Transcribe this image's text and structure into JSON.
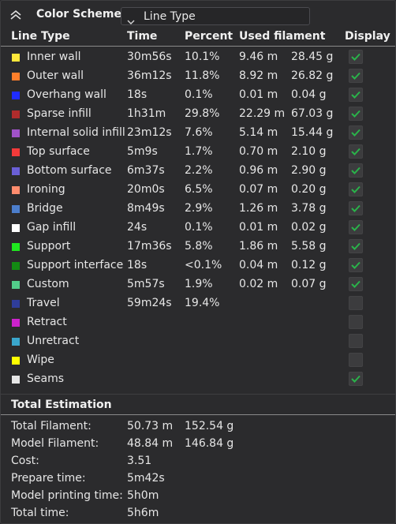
{
  "header": {
    "title": "Color Scheme",
    "view_type": "Line Type"
  },
  "columns": {
    "line_type": "Line Type",
    "time": "Time",
    "percent": "Percent",
    "used_filament": "Used filament",
    "display": "Display"
  },
  "rows": [
    {
      "label": "Inner wall",
      "color": "#ffe83b",
      "time": "30m56s",
      "percent": "10.1%",
      "length": "9.46 m",
      "weight": "28.45 g",
      "display": true
    },
    {
      "label": "Outer wall",
      "color": "#ff7f2b",
      "time": "36m12s",
      "percent": "11.8%",
      "length": "8.92 m",
      "weight": "26.82 g",
      "display": true
    },
    {
      "label": "Overhang wall",
      "color": "#1f2cff",
      "time": "18s",
      "percent": "0.1%",
      "length": "0.01 m",
      "weight": "0.04 g",
      "display": true
    },
    {
      "label": "Sparse infill",
      "color": "#b02c2c",
      "time": "1h31m",
      "percent": "29.8%",
      "length": "22.29 m",
      "weight": "67.03 g",
      "display": true
    },
    {
      "label": "Internal solid infill",
      "color": "#a052c8",
      "time": "23m12s",
      "percent": "7.6%",
      "length": "5.14 m",
      "weight": "15.44 g",
      "display": true
    },
    {
      "label": "Top surface",
      "color": "#f23a3a",
      "time": "5m9s",
      "percent": "1.7%",
      "length": "0.70 m",
      "weight": "2.10 g",
      "display": true
    },
    {
      "label": "Bottom surface",
      "color": "#6a5fd6",
      "time": "6m37s",
      "percent": "2.2%",
      "length": "0.96 m",
      "weight": "2.90 g",
      "display": true
    },
    {
      "label": "Ironing",
      "color": "#ff8c6e",
      "time": "20m0s",
      "percent": "6.5%",
      "length": "0.07 m",
      "weight": "0.20 g",
      "display": true
    },
    {
      "label": "Bridge",
      "color": "#4c7ecc",
      "time": "8m49s",
      "percent": "2.9%",
      "length": "1.26 m",
      "weight": "3.78 g",
      "display": true
    },
    {
      "label": "Gap infill",
      "color": "#ffffff",
      "time": "24s",
      "percent": "0.1%",
      "length": "0.01 m",
      "weight": "0.02 g",
      "display": true
    },
    {
      "label": "Support",
      "color": "#1fe81f",
      "time": "17m36s",
      "percent": "5.8%",
      "length": "1.86 m",
      "weight": "5.58 g",
      "display": true
    },
    {
      "label": "Support interface",
      "color": "#138a13",
      "time": "18s",
      "percent": "<0.1%",
      "length": "0.04 m",
      "weight": "0.12 g",
      "display": true
    },
    {
      "label": "Custom",
      "color": "#52cc8a",
      "time": "5m57s",
      "percent": "1.9%",
      "length": "0.02 m",
      "weight": "0.07 g",
      "display": true
    },
    {
      "label": "Travel",
      "color": "#2f3d9a",
      "time": "59m24s",
      "percent": "19.4%",
      "length": "",
      "weight": "",
      "display": false
    },
    {
      "label": "Retract",
      "color": "#cc22cc",
      "time": "",
      "percent": "",
      "length": "",
      "weight": "",
      "display": false
    },
    {
      "label": "Unretract",
      "color": "#3aa6cc",
      "time": "",
      "percent": "",
      "length": "",
      "weight": "",
      "display": false
    },
    {
      "label": "Wipe",
      "color": "#ffff00",
      "time": "",
      "percent": "",
      "length": "",
      "weight": "",
      "display": false
    },
    {
      "label": "Seams",
      "color": "#e6e6e6",
      "time": "",
      "percent": "",
      "length": "",
      "weight": "",
      "display": true
    }
  ],
  "totals": {
    "title": "Total Estimation",
    "items": [
      {
        "label": "Total Filament:",
        "value": "50.73 m",
        "value2": "152.54 g"
      },
      {
        "label": "Model Filament:",
        "value": "48.84 m",
        "value2": "146.84 g"
      },
      {
        "label": "Cost:",
        "value": "3.51",
        "value2": ""
      },
      {
        "label": "Prepare time:",
        "value": "5m42s",
        "value2": ""
      },
      {
        "label": "Model printing time:",
        "value": "5h0m",
        "value2": ""
      },
      {
        "label": "Total time:",
        "value": "5h6m",
        "value2": ""
      }
    ]
  },
  "colors": {
    "background": "#2b2b2d",
    "check": "#2ab34a",
    "divider": "#8a8a8a"
  },
  "icons": {
    "collapse": "double-chevron-up-icon",
    "dropdown": "chevron-down-icon",
    "check": "checkmark-icon"
  }
}
